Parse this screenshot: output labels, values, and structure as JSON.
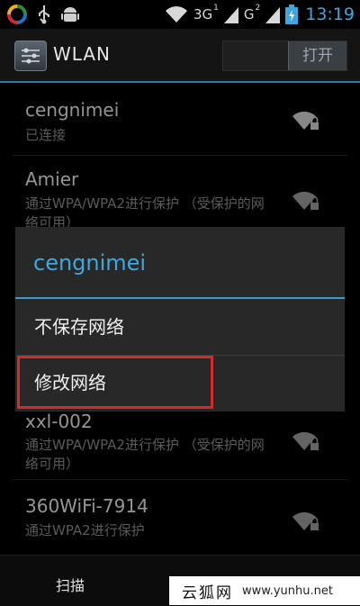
{
  "status_bar": {
    "icons": [
      "sync-icon",
      "usb-icon",
      "android-icon",
      "wifi-icon",
      "signal-3g-icon",
      "signal-g-icon",
      "battery-charging-icon"
    ],
    "net1": "3G",
    "net1_sub": "1",
    "net2": "G",
    "net2_sub": "2",
    "time": "13:19"
  },
  "action_bar": {
    "title": "WLAN",
    "toggle_on_label": "打开"
  },
  "networks": [
    {
      "name": "cengnimei",
      "status": "已连接",
      "icon": "wifi-secured-icon"
    },
    {
      "name": "Amier",
      "status": "通过WPA/WPA2进行保护 （受保护的网络可用）",
      "icon": "wifi-secured-icon"
    },
    {
      "name": "xxl-002",
      "status": "通过WPA/WPA2进行保护 （受保护的网络可用）",
      "icon": "wifi-secured-icon"
    },
    {
      "name": "360WiFi-7914",
      "status": "通过WPA2进行保护",
      "icon": "wifi-secured-icon"
    }
  ],
  "dialog": {
    "title": "cengnimei",
    "items": [
      "不保存网络",
      "修改网络"
    ]
  },
  "bottom_bar": {
    "scan_label": "扫描"
  },
  "watermark": {
    "cn": "云狐网",
    "url": "www.yunhu.net"
  },
  "colors": {
    "accent": "#3fa7dc",
    "highlight_box": "#d32a2a",
    "dialog_bg": "#282828"
  }
}
